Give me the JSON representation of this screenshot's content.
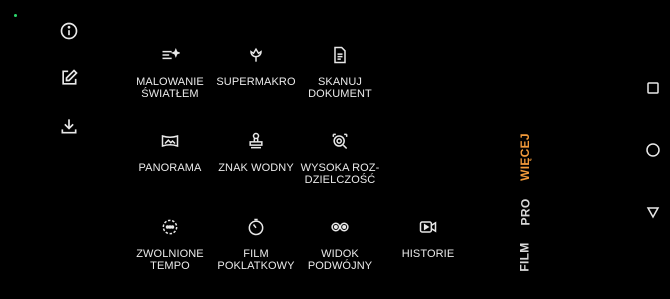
{
  "rail": {
    "buttons": [
      {
        "icon": "info-icon",
        "name": "info-button"
      },
      {
        "icon": "edit-icon",
        "name": "edit-button"
      },
      {
        "icon": "download-icon",
        "name": "download-button"
      }
    ]
  },
  "grid": {
    "tiles": [
      {
        "icon": "light-painting-icon",
        "label": "MALOWANIE\nŚWIATŁEM"
      },
      {
        "icon": "flower-macro-icon",
        "label": "SUPERMAKRO"
      },
      {
        "icon": "document-scan-icon",
        "label": "SKANUJ\nDOKUMENT"
      },
      {
        "icon": "panorama-icon",
        "label": "PANORAMA"
      },
      {
        "icon": "watermark-stamp-icon",
        "label": "ZNAK WODNY"
      },
      {
        "icon": "high-resolution-icon",
        "label": "WYSOKA ROZ-\nDZIELCZOŚĆ"
      },
      {
        "icon": "slow-motion-icon",
        "label": "ZWOLNIONE\nTEMPO"
      },
      {
        "icon": "timelapse-icon",
        "label": "FILM\nPOKLATKOWY"
      },
      {
        "icon": "dual-view-icon",
        "label": "WIDOK\nPODWÓJNY"
      },
      {
        "icon": "stories-icon",
        "label": "HISTORIE"
      }
    ]
  },
  "modes": {
    "items": [
      {
        "label": "WIĘCEJ",
        "active": true
      },
      {
        "label": "PRO",
        "active": false
      },
      {
        "label": "FILM",
        "active": false
      }
    ]
  },
  "navbar": {
    "buttons": [
      {
        "icon": "recents-square-icon",
        "name": "recents-button"
      },
      {
        "icon": "home-circle-icon",
        "name": "home-button"
      },
      {
        "icon": "back-triangle-icon",
        "name": "back-button"
      }
    ]
  },
  "colors": {
    "accent": "#f29a3a",
    "background": "#000000",
    "status_dot": "#2bd66b"
  }
}
